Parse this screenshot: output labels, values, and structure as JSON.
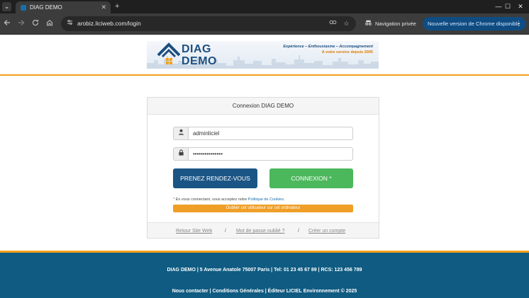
{
  "browser": {
    "tab_title": "DIAG DEMO",
    "tab_close": "✕",
    "new_tab": "+",
    "url": "arobiz.liciweb.com/login",
    "incognito_label": "Navigation privée",
    "update_label": "Nouvelle version de Chrome disponible",
    "window_controls": {
      "minimize": "—",
      "maximize": "☐",
      "close": "✕"
    }
  },
  "header": {
    "logo_line_1": "DIAG",
    "logo_line_2": "DEMO",
    "tagline_1": "Expérience – Enthousiasme – Accompagnement",
    "tagline_2": "A votre service depuis 2005"
  },
  "login": {
    "title": "Connexion  DIAG DEMO",
    "username_value": "adminliciel",
    "password_value": "•••••••••••••••",
    "appointment_button": "PRENEZ RENDEZ-VOUS",
    "connect_button": "CONNEXION *",
    "consent_star": "*",
    "consent_text": " En vous connectant, vous acceptez notre ",
    "consent_link": "Politique de Cookies",
    "consent_end": ".",
    "forget_user_button": "Oublier cet utilisateur sur cet ordinateur",
    "footer_links": {
      "back_to_site": "Retour Site Web",
      "forgot_password": "Mot de passe oublié ?",
      "create_account": "Créer un compte",
      "separator": "/"
    }
  },
  "footer": {
    "address_line": "DIAG DEMO | 5 Avenue Anatole 75007 Paris | Tel: 01 23 45 67 89 | RCS: 123 456 789",
    "links_line": "Nous contacter | Conditions Générales | Éditeur LICIEL Environnement © 2025"
  },
  "colors": {
    "brand_blue": "#1c4f7f",
    "accent_orange": "#f3a21b",
    "connect_green": "#4cb85c",
    "appointment_blue": "#1b5585",
    "footer_blue": "#0f5b82"
  },
  "icons": {
    "username": "user-icon",
    "password": "lock-icon",
    "back": "arrow-left-icon",
    "forward": "arrow-right-icon",
    "reload": "reload-icon",
    "home": "home-icon",
    "bookmark": "star-icon",
    "password_manager": "key-icon"
  }
}
